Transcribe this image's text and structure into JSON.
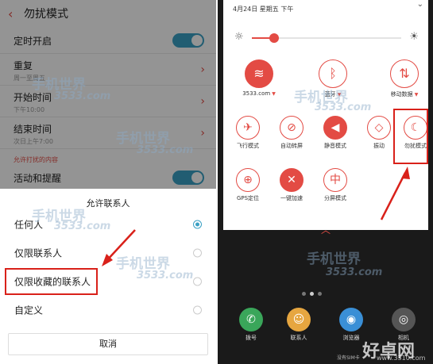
{
  "left": {
    "title": "勿扰模式",
    "rows": [
      {
        "title": "定时开启"
      },
      {
        "title": "重复",
        "sub": "周一至周五"
      },
      {
        "title": "开始时间",
        "sub": "下午10:00"
      },
      {
        "title": "结束时间",
        "sub": "次日上午7:00"
      }
    ],
    "section": "允许打扰的内容",
    "activity": "活动和提醒",
    "sheet": {
      "title": "允许联系人",
      "options": [
        {
          "label": "任何人",
          "selected": true
        },
        {
          "label": "仅限联系人",
          "selected": false
        },
        {
          "label": "仅限收藏的联系人",
          "selected": false
        },
        {
          "label": "自定义",
          "selected": false
        }
      ],
      "cancel": "取消"
    }
  },
  "right": {
    "date": "4月24日 星期五 下午",
    "brightness": 0.15,
    "tiles": [
      {
        "label": "3533.com",
        "icon": "wifi-icon",
        "glyph": "≋",
        "active": true,
        "dropdown": true
      },
      {
        "label": "蓝牙",
        "icon": "bluetooth-icon",
        "glyph": "ᛒ",
        "active": false,
        "dropdown": true
      },
      {
        "label": "移动数据",
        "icon": "mobile-data-icon",
        "glyph": "⇅",
        "active": false,
        "dropdown": true
      },
      {
        "label": "飞行模式",
        "icon": "airplane-icon",
        "glyph": "✈",
        "active": false
      },
      {
        "label": "自动转屏",
        "icon": "rotate-icon",
        "glyph": "⊘",
        "active": false
      },
      {
        "label": "静音模式",
        "icon": "mute-icon",
        "glyph": "◀",
        "active": true
      },
      {
        "label": "振动",
        "icon": "vibrate-icon",
        "glyph": "◇",
        "active": false
      },
      {
        "label": "勿扰模式",
        "icon": "moon-icon",
        "glyph": "☾",
        "active": false
      },
      {
        "label": "GPS定位",
        "icon": "gps-icon",
        "glyph": "⊕",
        "active": false
      },
      {
        "label": "一键加速",
        "icon": "boost-icon",
        "glyph": "✕",
        "active": true
      },
      {
        "label": "分屏模式",
        "icon": "split-screen-icon",
        "glyph": "中",
        "active": false
      }
    ],
    "dock": [
      {
        "label": "拨号",
        "icon": "phone-icon",
        "glyph": "✆",
        "color": "#3aa65a"
      },
      {
        "label": "联系人",
        "icon": "contacts-icon",
        "glyph": "☺",
        "color": "#e6a640"
      },
      {
        "label": "浏览器",
        "icon": "browser-icon",
        "glyph": "◉",
        "color": "#3a8fd6"
      },
      {
        "label": "相机",
        "icon": "camera-icon",
        "glyph": "◎",
        "color": "#555555"
      }
    ],
    "no_sim": "没有SIM卡"
  },
  "watermark": {
    "brand": "手机世界",
    "domain": "3533.com",
    "brand2": "好卓网",
    "url2": "www.3310.com"
  },
  "colors": {
    "accent": "#e34b44",
    "toggle": "#3aa0c4",
    "highlight": "#d9211a"
  }
}
